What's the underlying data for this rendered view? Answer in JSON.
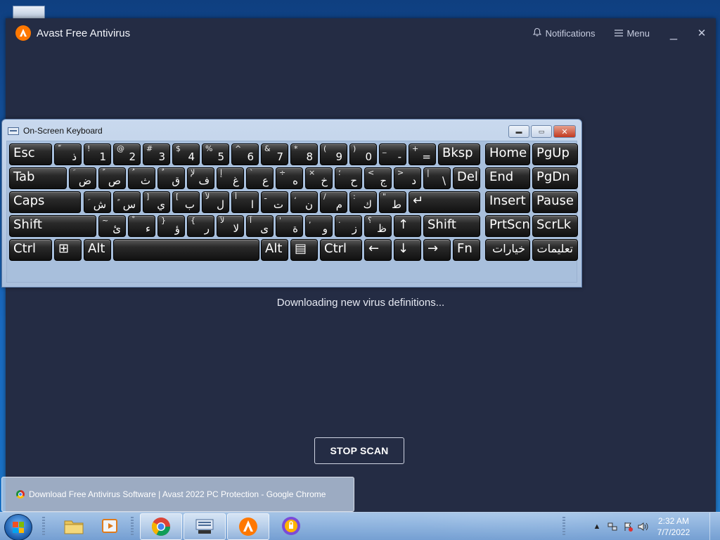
{
  "avast": {
    "title": "Avast Free Antivirus",
    "notifications_label": "Notifications",
    "menu_label": "Menu",
    "minimize_glyph": "_",
    "close_glyph": "✕",
    "status_text": "Downloading new virus definitions...",
    "stop_scan_label": "STOP SCAN",
    "accent_color": "#ff7800"
  },
  "osk": {
    "title": "On-Screen Keyboard",
    "rows": [
      [
        {
          "main": "Esc"
        },
        {
          "sub": "ّ",
          "ar": "ذ"
        },
        {
          "sub": "!",
          "ar": "1"
        },
        {
          "sub": "@",
          "ar": "2"
        },
        {
          "sub": "#",
          "ar": "3"
        },
        {
          "sub": "$",
          "ar": "4"
        },
        {
          "sub": "%",
          "ar": "5"
        },
        {
          "sub": "^",
          "ar": "6"
        },
        {
          "sub": "&",
          "ar": "7"
        },
        {
          "sub": "*",
          "ar": "8"
        },
        {
          "sub": "(",
          "ar": "9"
        },
        {
          "sub": ")",
          "ar": "0"
        },
        {
          "sub": "_",
          "ar": "-"
        },
        {
          "sub": "+",
          "ar": "="
        },
        {
          "main": "Bksp"
        },
        {
          "main": "Home"
        },
        {
          "main": "PgUp"
        }
      ],
      [
        {
          "main": "Tab"
        },
        {
          "sub": "َ",
          "ar": "ض"
        },
        {
          "sub": "ً",
          "ar": "ص"
        },
        {
          "sub": "ُ",
          "ar": "ث"
        },
        {
          "sub": "ٌ",
          "ar": "ق"
        },
        {
          "sub": "لإ",
          "ar": "ف"
        },
        {
          "sub": "إ",
          "ar": "غ"
        },
        {
          "sub": "`",
          "ar": "ع"
        },
        {
          "sub": "÷",
          "ar": "ه"
        },
        {
          "sub": "×",
          "ar": "خ"
        },
        {
          "sub": "؛",
          "ar": "ح"
        },
        {
          "sub": "<",
          "ar": "ج"
        },
        {
          "sub": ">",
          "ar": "د"
        },
        {
          "sub": "|",
          "ar": "\\"
        },
        {
          "main": "Del"
        },
        {
          "main": "End"
        },
        {
          "main": "PgDn"
        }
      ],
      [
        {
          "main": "Caps"
        },
        {
          "sub": "ِ",
          "ar": "ش"
        },
        {
          "sub": "ٍ",
          "ar": "س"
        },
        {
          "sub": "]",
          "ar": "ي"
        },
        {
          "sub": "[",
          "ar": "ب"
        },
        {
          "sub": "لأ",
          "ar": "ل"
        },
        {
          "sub": "أ",
          "ar": "ا"
        },
        {
          "sub": "ـ",
          "ar": "ت"
        },
        {
          "sub": "،",
          "ar": "ن"
        },
        {
          "sub": "/",
          "ar": "م"
        },
        {
          "sub": ":",
          "ar": "ك"
        },
        {
          "sub": "\"",
          "ar": "ط"
        },
        {
          "main": "↵"
        },
        {
          "main": "Insert"
        },
        {
          "main": "Pause"
        }
      ],
      [
        {
          "main": "Shift"
        },
        {
          "sub": "~",
          "ar": "ئ"
        },
        {
          "sub": "ْ",
          "ar": "ء"
        },
        {
          "sub": "}",
          "ar": "ؤ"
        },
        {
          "sub": "{",
          "ar": "ر"
        },
        {
          "sub": "لآ",
          "ar": "لا"
        },
        {
          "sub": "آ",
          "ar": "ى"
        },
        {
          "sub": "'",
          "ar": "ة"
        },
        {
          "sub": ",",
          "ar": "و"
        },
        {
          "sub": ".",
          "ar": "ز"
        },
        {
          "sub": "؟",
          "ar": "ظ"
        },
        {
          "main": "↑"
        },
        {
          "main": "Shift"
        },
        {
          "main": "PrtScn"
        },
        {
          "main": "ScrLk"
        }
      ],
      [
        {
          "main": "Ctrl"
        },
        {
          "main": "⊞"
        },
        {
          "main": "Alt"
        },
        {
          "main": ""
        },
        {
          "main": "Alt"
        },
        {
          "main": "▤"
        },
        {
          "main": "Ctrl"
        },
        {
          "main": "←"
        },
        {
          "main": "↓"
        },
        {
          "main": "→"
        },
        {
          "main": "Fn"
        },
        {
          "main": "خيارات"
        },
        {
          "main": "تعليمات"
        }
      ]
    ]
  },
  "chrome_preview": {
    "label": "Download Free Antivirus Software | Avast 2022 PC Protection - Google Chrome"
  },
  "taskbar": {
    "items": [
      "explorer-icon",
      "media-player-icon",
      "chrome-icon",
      "osk-icon",
      "avast-icon",
      "avast-secure-browser-icon"
    ],
    "clock_time": "2:32 AM",
    "clock_date": "7/7/2022"
  }
}
